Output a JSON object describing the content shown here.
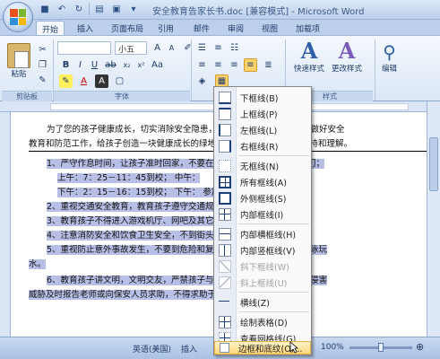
{
  "window": {
    "title": "安全教育告家长书.doc [兼容模式] - Microsoft Word"
  },
  "tabs": [
    "开始",
    "插入",
    "页面布局",
    "引用",
    "邮件",
    "审阅",
    "视图",
    "加载项"
  ],
  "ribbon": {
    "paste_label": "粘贴",
    "clipboard_group": "剪贴板",
    "font_group": "字体",
    "styles_group": "样式",
    "font_size": "小五",
    "quick_styles": "快速样式",
    "change_styles": "更改样式",
    "edit_label": "编辑"
  },
  "document": {
    "lines": [
      "为了您的孩子健康成长，切实消除安全隐患，在此我们期待着和您一起做好安全",
      "教育和防范工作，给孩子创造一块健康成长的绿地。为此，希望得到您的支持和理解。",
      "1、严守作息时间，让孩子准时回家，不要在路上逗留，不要过早到校门；",
      "上午：7：25－11：45到校；  中午：",
      "下午：2：15－16：15到校；  下午：                 参加课外体育训练。",
      "2、重视交通安全教育，教育孩子遵守交通规则",
      "3、教育孩子不得进入游戏机厅、网吧及其它",
      "4、注意消防安全和饮食卫生安全，不到街头                 吃零食。",
      "5、重视防止意外事故发生，不要到危险和复杂               外出，严禁私自下河游泳玩",
      "水。",
      "6、教育孩子讲文明，文明交友，严禁孩子与社会              生矛盾、纠纷或受到侵害",
      "威胁及时报告老师或向保安人员求助，不得求助于"
    ]
  },
  "dropdown": {
    "items": [
      {
        "label": "下框线(B)",
        "icon": "border-bottom-icon"
      },
      {
        "label": "上框线(P)",
        "icon": "border-top-icon"
      },
      {
        "label": "左框线(L)",
        "icon": "border-left-icon"
      },
      {
        "label": "右框线(R)",
        "icon": "border-right-icon"
      },
      {
        "label": "无框线(N)",
        "icon": "border-none-icon"
      },
      {
        "label": "所有框线(A)",
        "icon": "border-all-icon"
      },
      {
        "label": "外侧框线(S)",
        "icon": "border-outside-icon"
      },
      {
        "label": "内部框线(I)",
        "icon": "border-inside-icon"
      },
      {
        "label": "内部横框线(H)",
        "icon": "border-inside-horizontal-icon"
      },
      {
        "label": "内部竖框线(V)",
        "icon": "border-inside-vertical-icon"
      },
      {
        "label": "斜下框线(W)",
        "icon": "border-diagonal-down-icon",
        "disabled": true
      },
      {
        "label": "斜上框线(U)",
        "icon": "border-diagonal-up-icon",
        "disabled": true
      },
      {
        "label": "横线(Z)",
        "icon": "horizontal-line-icon"
      },
      {
        "label": "绘制表格(D)",
        "icon": "draw-table-icon"
      },
      {
        "label": "查看网格线(G)",
        "icon": "view-gridlines-icon"
      },
      {
        "label": "边框和底纹(O)...",
        "icon": "borders-shading-icon",
        "hover": true
      }
    ]
  },
  "statusbar": {
    "language": "英语(美国)",
    "insert_mode": "插入",
    "zoom": "100%"
  },
  "colors": {
    "selection": "#b7bfe6",
    "hover": "#ffd77a",
    "ribbon": "#dbe7f6"
  }
}
